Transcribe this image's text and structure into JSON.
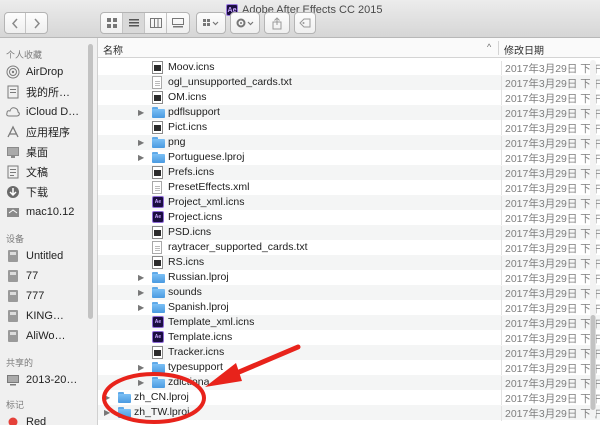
{
  "window": {
    "title": "Adobe After Effects CC 2015",
    "app_badge": "Ae"
  },
  "toolbar": {
    "back_icon": "chevron-left-icon",
    "forward_icon": "chevron-right-icon",
    "view_modes": [
      "icon-view-icon",
      "list-view-icon",
      "column-view-icon",
      "cover-flow-icon"
    ],
    "active_view": "list-view-icon",
    "arrange_icon": "arrange-grid-icon",
    "action_icon": "gear-icon",
    "share_icon": "share-icon",
    "tags_icon": "tag-icon"
  },
  "sidebar": {
    "sections": [
      {
        "header": "个人收藏",
        "items": [
          {
            "label": "AirDrop",
            "icon": "airdrop-icon"
          },
          {
            "label": "我的所…",
            "icon": "all-files-icon"
          },
          {
            "label": "iCloud D…",
            "icon": "cloud-icon"
          },
          {
            "label": "应用程序",
            "icon": "applications-icon"
          },
          {
            "label": "桌面",
            "icon": "desktop-icon"
          },
          {
            "label": "文稿",
            "icon": "documents-icon"
          },
          {
            "label": "下载",
            "icon": "download-icon"
          },
          {
            "label": "mac10.12",
            "icon": "home-folder-icon"
          }
        ]
      },
      {
        "header": "设备",
        "items": [
          {
            "label": "Untitled",
            "icon": "disk-icon"
          },
          {
            "label": "77",
            "icon": "disk-icon"
          },
          {
            "label": "777",
            "icon": "disk-icon"
          },
          {
            "label": "KING…",
            "icon": "disk-icon"
          },
          {
            "label": "AliWo…",
            "icon": "disk-icon"
          }
        ]
      },
      {
        "header": "共享的",
        "items": [
          {
            "label": "2013-20…",
            "icon": "shared-computer-icon"
          }
        ]
      },
      {
        "header": "标记",
        "items": [
          {
            "label": "Red",
            "icon": "red-tag-dot-icon",
            "color": "#e5413a"
          }
        ]
      }
    ]
  },
  "filelist": {
    "columns": {
      "name": "名称",
      "date": "修改日期"
    },
    "sort_indicator": "chevron-up-icon",
    "rows": [
      {
        "name": "Moov.icns",
        "kind": "icns",
        "date": "2017年3月29日 下午",
        "expandable": false,
        "indent": 1
      },
      {
        "name": "ogl_unsupported_cards.txt",
        "kind": "txt",
        "date": "2017年3月29日 下午",
        "expandable": false,
        "indent": 1
      },
      {
        "name": "OM.icns",
        "kind": "icns",
        "date": "2017年3月29日 下午",
        "expandable": false,
        "indent": 1
      },
      {
        "name": "pdflsupport",
        "kind": "folder",
        "date": "2017年3月29日 下午",
        "expandable": true,
        "indent": 1
      },
      {
        "name": "Pict.icns",
        "kind": "icns",
        "date": "2017年3月29日 下午",
        "expandable": false,
        "indent": 1
      },
      {
        "name": "png",
        "kind": "folder",
        "date": "2017年3月29日 下午",
        "expandable": true,
        "indent": 1
      },
      {
        "name": "Portuguese.lproj",
        "kind": "folder",
        "date": "2017年3月29日 下午",
        "expandable": true,
        "indent": 1
      },
      {
        "name": "Prefs.icns",
        "kind": "icns",
        "date": "2017年3月29日 下午",
        "expandable": false,
        "indent": 1
      },
      {
        "name": "PresetEffects.xml",
        "kind": "txt",
        "date": "2017年3月29日 下午",
        "expandable": false,
        "indent": 1
      },
      {
        "name": "Project_xml.icns",
        "kind": "ae",
        "date": "2017年3月29日 下午",
        "expandable": false,
        "indent": 1
      },
      {
        "name": "Project.icns",
        "kind": "ae",
        "date": "2017年3月29日 下午",
        "expandable": false,
        "indent": 1
      },
      {
        "name": "PSD.icns",
        "kind": "icns",
        "date": "2017年3月29日 下午",
        "expandable": false,
        "indent": 1
      },
      {
        "name": "raytracer_supported_cards.txt",
        "kind": "txt",
        "date": "2017年3月29日 下午",
        "expandable": false,
        "indent": 1
      },
      {
        "name": "RS.icns",
        "kind": "icns",
        "date": "2017年3月29日 下午",
        "expandable": false,
        "indent": 1
      },
      {
        "name": "Russian.lproj",
        "kind": "folder",
        "date": "2017年3月29日 下午",
        "expandable": true,
        "indent": 1
      },
      {
        "name": "sounds",
        "kind": "folder",
        "date": "2017年3月29日 下午",
        "expandable": true,
        "indent": 1
      },
      {
        "name": "Spanish.lproj",
        "kind": "folder",
        "date": "2017年3月29日 下午",
        "expandable": true,
        "indent": 1
      },
      {
        "name": "Template_xml.icns",
        "kind": "ae",
        "date": "2017年3月29日 下午",
        "expandable": false,
        "indent": 1
      },
      {
        "name": "Template.icns",
        "kind": "ae",
        "date": "2017年3月29日 下午",
        "expandable": false,
        "indent": 1
      },
      {
        "name": "Tracker.icns",
        "kind": "icns",
        "date": "2017年3月29日 下午",
        "expandable": false,
        "indent": 1
      },
      {
        "name": "typesupport",
        "kind": "folder",
        "date": "2017年3月29日 下午",
        "expandable": true,
        "indent": 1
      },
      {
        "name": "zdictiona",
        "kind": "folder",
        "date": "2017年3月29日 下午",
        "expandable": true,
        "indent": 1
      },
      {
        "name": "zh_CN.lproj",
        "kind": "folder",
        "date": "2017年3月29日 下午",
        "expandable": true,
        "indent": 0
      },
      {
        "name": "zh_TW.lproj",
        "kind": "folder",
        "date": "2017年3月29日 下午",
        "expandable": true,
        "indent": 0
      }
    ]
  },
  "annotation": {
    "color": "#e8231b",
    "arrow_icon": "red-arrow-annotation",
    "ellipse_icon": "red-ellipse-annotation"
  }
}
